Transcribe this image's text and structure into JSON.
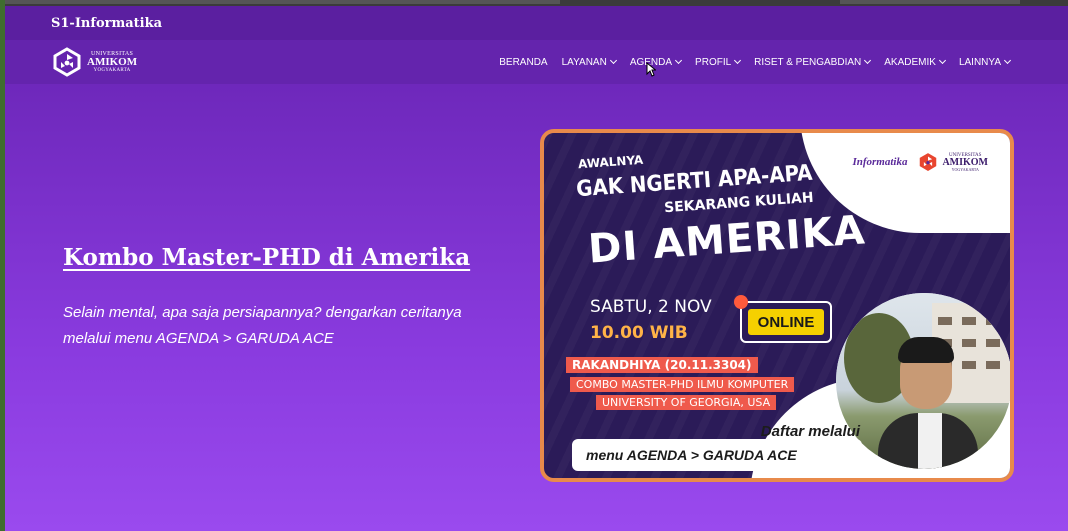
{
  "topbar": {
    "site_name": "S1-Informatika"
  },
  "logo": {
    "line1": "UNIVERSITAS",
    "line2": "AMIKOM",
    "line3": "YOGYAKARTA",
    "icon": "amikom-logo-icon"
  },
  "nav": {
    "items": [
      {
        "label": "BERANDA",
        "dropdown": false
      },
      {
        "label": "LAYANAN",
        "dropdown": true
      },
      {
        "label": "AGENDA",
        "dropdown": true
      },
      {
        "label": "PROFIL",
        "dropdown": true
      },
      {
        "label": "RISET & PENGABDIAN",
        "dropdown": true
      },
      {
        "label": "AKADEMIK",
        "dropdown": true
      },
      {
        "label": "LAINNYA",
        "dropdown": true
      }
    ]
  },
  "hero": {
    "title": "Kombo Master-PHD di Amerika",
    "description": "Selain mental, apa saja persiapannya? dengarkan ceritanya melalui menu AGENDA > GARUDA ACE"
  },
  "poster": {
    "line_awalnya": "AWALNYA",
    "line_gak": "GAK NGERTI APA-APA",
    "line_sekarang": "SEKARANG KULIAH",
    "line_amerika": "DI AMERIKA",
    "date": "SABTU, 2 NOV",
    "time": "10.00 WIB",
    "online": "ONLINE",
    "speaker": "RAKANDHIYA (20.11.3304)",
    "program": "COMBO MASTER-PHD  ILMU KOMPUTER",
    "university": "UNIVERSITY OF GEORGIA, USA",
    "daftar": "Daftar melalui",
    "menu": "menu AGENDA > GARUDA ACE",
    "logo_informatika": "Informatika",
    "logo_amikom_1": "UNIVERSITAS",
    "logo_amikom_2": "AMIKOM",
    "logo_amikom_3": "YOGYAKARTA"
  },
  "colors": {
    "accent": "#6424ad",
    "poster_border": "#e88a4b",
    "tag": "#ef5a4c",
    "online": "#f5d000"
  }
}
